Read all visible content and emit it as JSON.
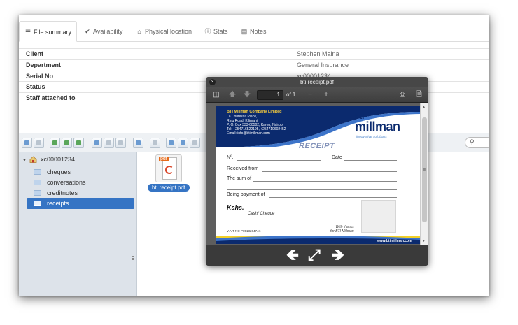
{
  "tabs": [
    {
      "label": "File summary",
      "icon": "list-icon",
      "active": true
    },
    {
      "label": "Availability",
      "icon": "check-icon",
      "active": false
    },
    {
      "label": "Physical location",
      "icon": "home-icon",
      "active": false
    },
    {
      "label": "Stats",
      "icon": "info-icon",
      "active": false
    },
    {
      "label": "Notes",
      "icon": "notes-icon",
      "active": false
    }
  ],
  "summary": [
    {
      "key": "Client",
      "value": "Stephen Maina"
    },
    {
      "key": "Department",
      "value": "General Insurance"
    },
    {
      "key": "Serial No",
      "value": "xc00001234"
    },
    {
      "key": "Status",
      "value": ""
    },
    {
      "key": "Staff attached to",
      "value": ""
    }
  ],
  "tree": {
    "root": "xc00001234",
    "folders": [
      "cheques",
      "conversations",
      "creditnotes",
      "receipts"
    ],
    "selected": "receipts"
  },
  "file": {
    "name": "bti receipt.pdf",
    "badge": "pdf"
  },
  "viewer": {
    "title": "bti receipt.pdf",
    "page_number": "1",
    "page_of": "of 1",
    "close_glyph": "×",
    "minus": "−",
    "plus": "+"
  },
  "receipt": {
    "company": "BTI Millman Company Limited",
    "address1": "La Contessa Place,",
    "address2": "Ring Road, Kilimani.",
    "address3": "P. O. Box 333-00502, Karen, Nairobi",
    "tel": "Tel: +254716522195, +254710602452",
    "email": "Email: info@btimillman.com",
    "logo_top": "bti",
    "logo_main": "millman",
    "tagline": "innovative solutions",
    "title": "RECEIPT",
    "no_label": "Nº.",
    "date_label": "Date",
    "received_from": "Received from",
    "sum_of": "The sum of",
    "payment_of": "Being payment of",
    "kshs": "Kshs.",
    "cash_cheque": "Cash/ Cheque",
    "thanks1": "With thanks",
    "thanks2": "for BTI Millman",
    "vat": "V.A.T NO P051326474K",
    "website": "www.btimillman.com"
  },
  "colors": {
    "accent": "#3574c4",
    "navy": "#0b2a6e",
    "yellow": "#f2d027"
  }
}
